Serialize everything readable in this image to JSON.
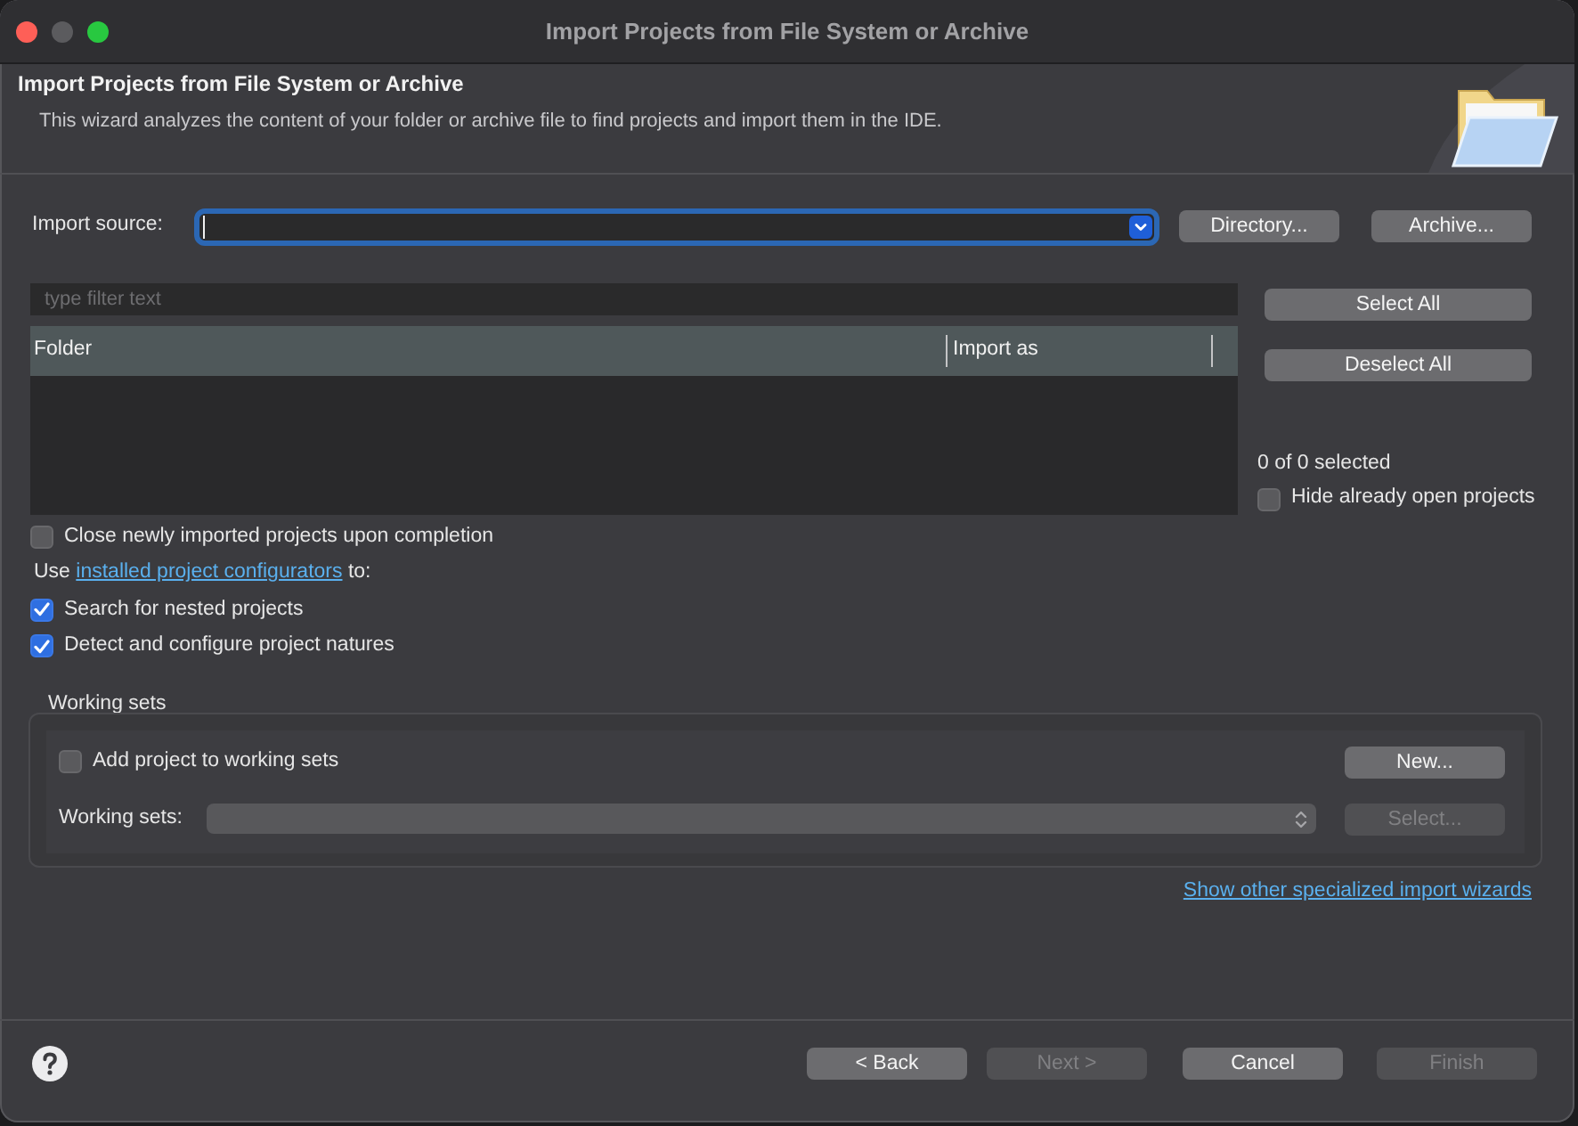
{
  "window": {
    "title": "Import Projects from File System or Archive",
    "controls": [
      {
        "kind": "close",
        "disabled": false
      },
      {
        "kind": "minimize",
        "disabled": true
      },
      {
        "kind": "zoom",
        "disabled": false
      }
    ]
  },
  "header": {
    "title": "Import Projects from File System or Archive",
    "description": "This wizard analyzes the content of your folder or archive file to find projects and import them in the IDE."
  },
  "import_source": {
    "label": "Import source:",
    "focused": true
  },
  "source_buttons": [
    {
      "label": "Directory...",
      "disabled": false
    },
    {
      "label": "Archive...",
      "disabled": false
    }
  ],
  "filter": {
    "placeholder": "type filter text"
  },
  "table": {
    "columns": [
      "Folder",
      "Import as"
    ]
  },
  "table_buttons": [
    {
      "label": "Select All",
      "disabled": false
    },
    {
      "label": "Deselect All",
      "disabled": false
    }
  ],
  "selection_count": "0 of 0 selected",
  "hide_open_projects": {
    "label": "Hide already open projects",
    "checked": false
  },
  "options": [
    {
      "kind": "checkbox",
      "label": "Close newly imported projects upon completion",
      "checked": false
    },
    {
      "kind": "link_text",
      "prefix": "Use",
      "link": "installed project configurators",
      "suffix": "to:"
    },
    {
      "kind": "checkbox",
      "label": "Search for nested projects",
      "checked": true
    },
    {
      "kind": "checkbox",
      "label": "Detect and configure project natures",
      "checked": true
    }
  ],
  "working_sets": {
    "title": "Working sets",
    "add_option": {
      "label": "Add project to working sets",
      "checked": false
    },
    "new_button": {
      "label": "New...",
      "disabled": false
    },
    "sets_label": "Working sets:",
    "sets_combo": {
      "disabled": true
    },
    "select_button": {
      "label": "Select...",
      "disabled": true
    }
  },
  "other_wizards_link": "Show other specialized import wizards",
  "footer_buttons": [
    {
      "label": "< Back",
      "disabled": false
    },
    {
      "label": "Next >",
      "disabled": true
    },
    {
      "label": "Cancel",
      "disabled": false
    },
    {
      "label": "Finish",
      "disabled": true
    }
  ]
}
